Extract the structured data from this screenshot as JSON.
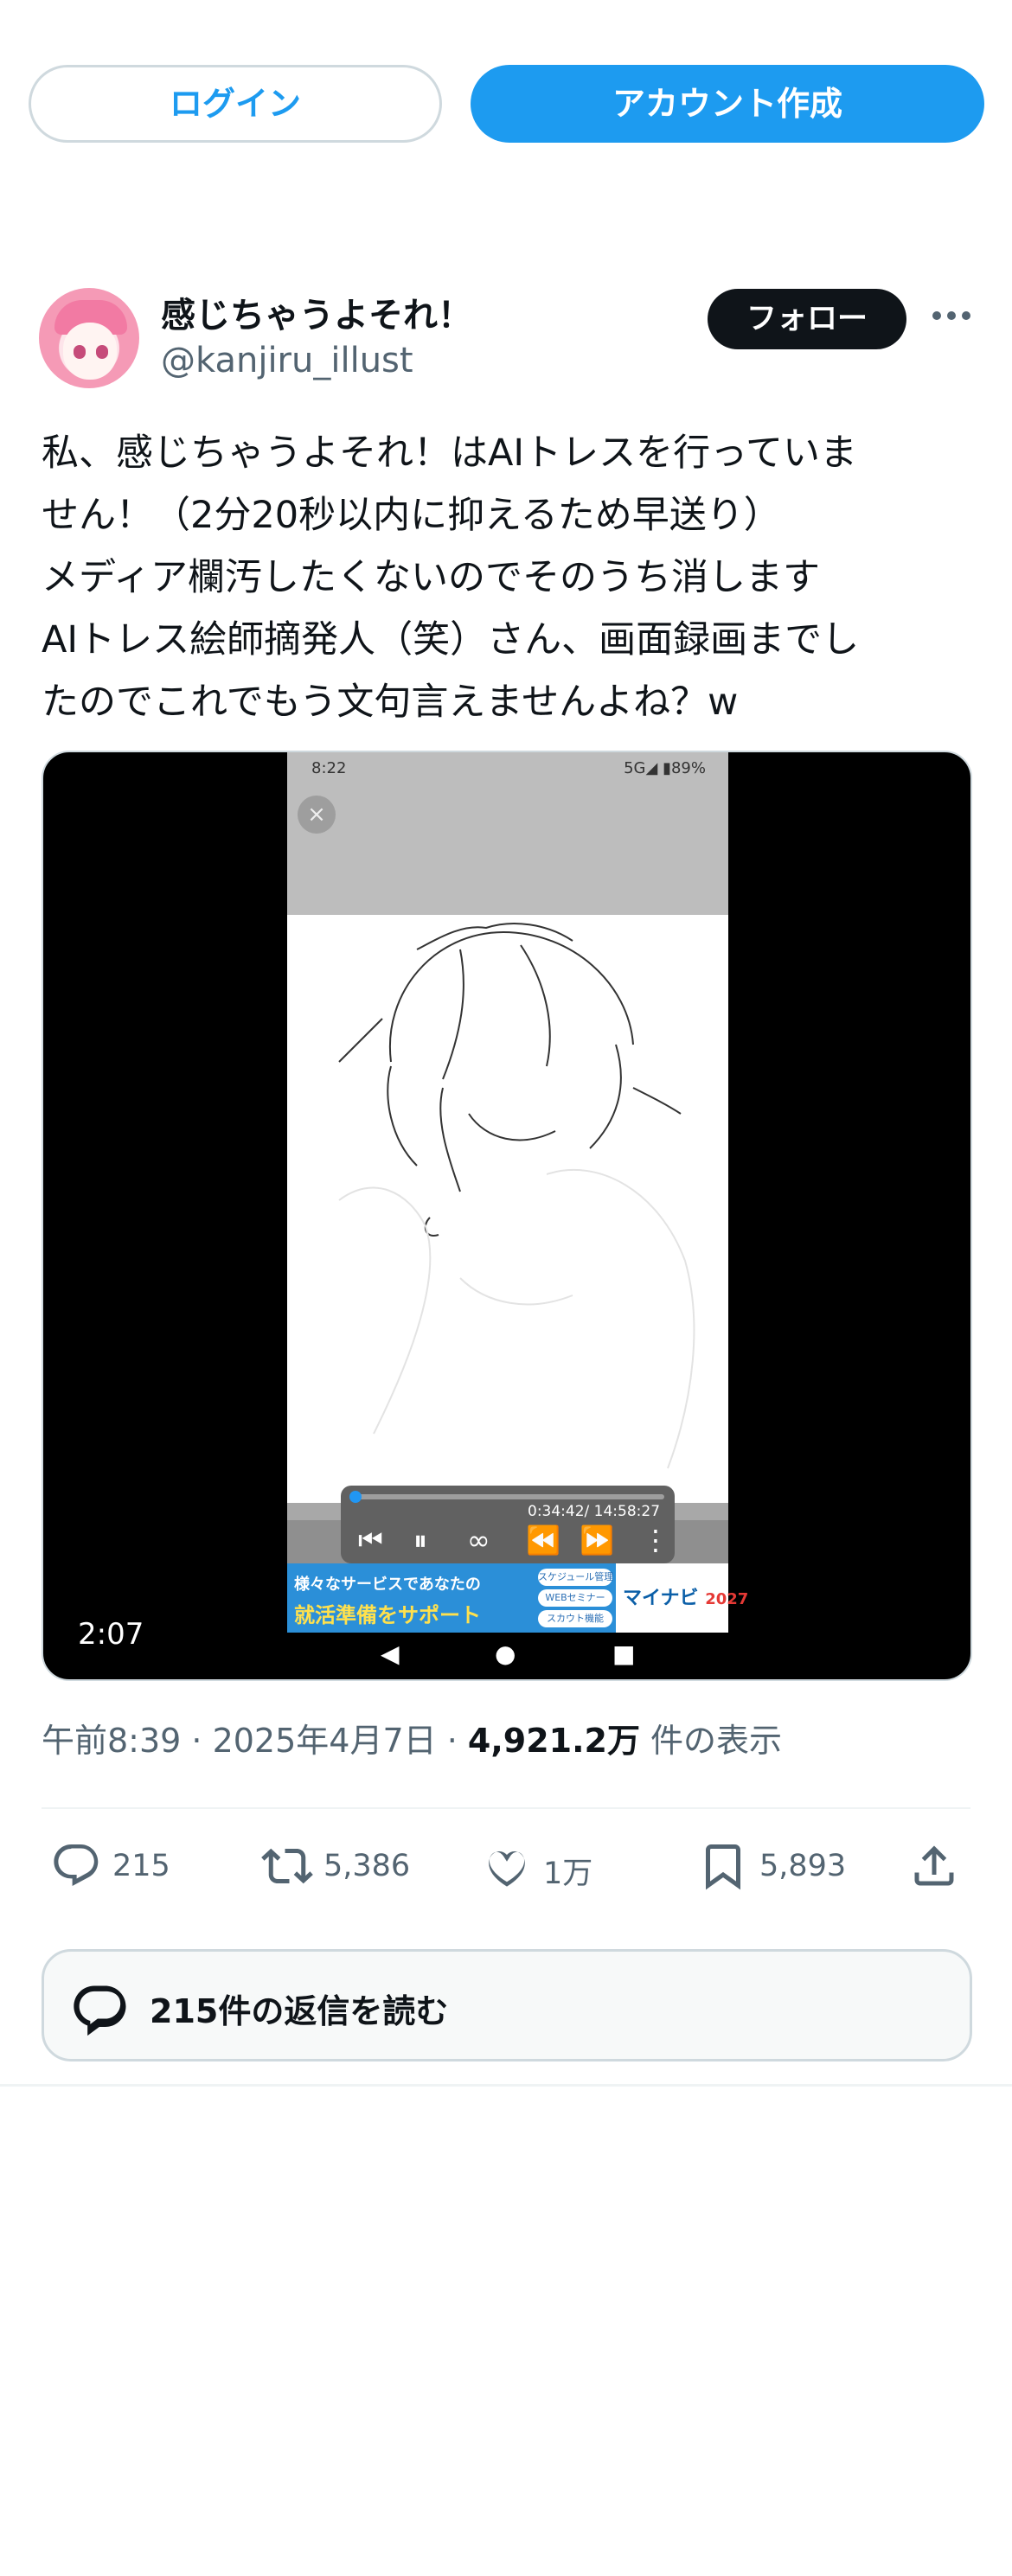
{
  "header": {
    "login_label": "ログイン",
    "signup_label": "アカウント作成"
  },
  "tweet": {
    "display_name": "感じちゃうよそれ！",
    "handle": "@kanjiru_illust",
    "follow_label": "フォロー",
    "text": "私、感じちゃうよそれ！はAIトレスを行っていま\nせん！（2分20秒以内に抑えるため早送り）\nメディア欄汚したくないのでそのうち消します\nAIトレス絵師摘発人（笑）さん、画面録画までし\nたのでこれでもう文句言えませんよね？w",
    "media": {
      "duration": "2:07",
      "phone_time": "8:22",
      "phone_status_right": "5G◢ ▮89%",
      "player_time": "0:34:42/ 14:58:27",
      "ad_line1": "様々なサービスであなたの",
      "ad_line2": "就活準備をサポート",
      "ad_pill1": "スケジュール管理",
      "ad_pill2": "WEBセミナー",
      "ad_pill3": "スカウト機能",
      "ad_brand": "マイナビ",
      "ad_year": "2027"
    },
    "timestamp": "午前8:39 · 2025年4月7日 · ",
    "views_count": "4,921.2万",
    "views_label": " 件の表示",
    "actions": {
      "replies": "215",
      "retweets": "5,386",
      "likes": "1万",
      "bookmarks": "5,893"
    },
    "read_replies_label": "215件の返信を読む"
  },
  "colors": {
    "accent": "#1d9bf0",
    "text": "#0f1419",
    "muted": "#536471",
    "border": "#cfd9de"
  },
  "icons": [
    "more-icon",
    "reply-icon",
    "retweet-icon",
    "like-icon",
    "bookmark-icon",
    "share-icon",
    "replies-bubble-icon",
    "close-icon"
  ]
}
